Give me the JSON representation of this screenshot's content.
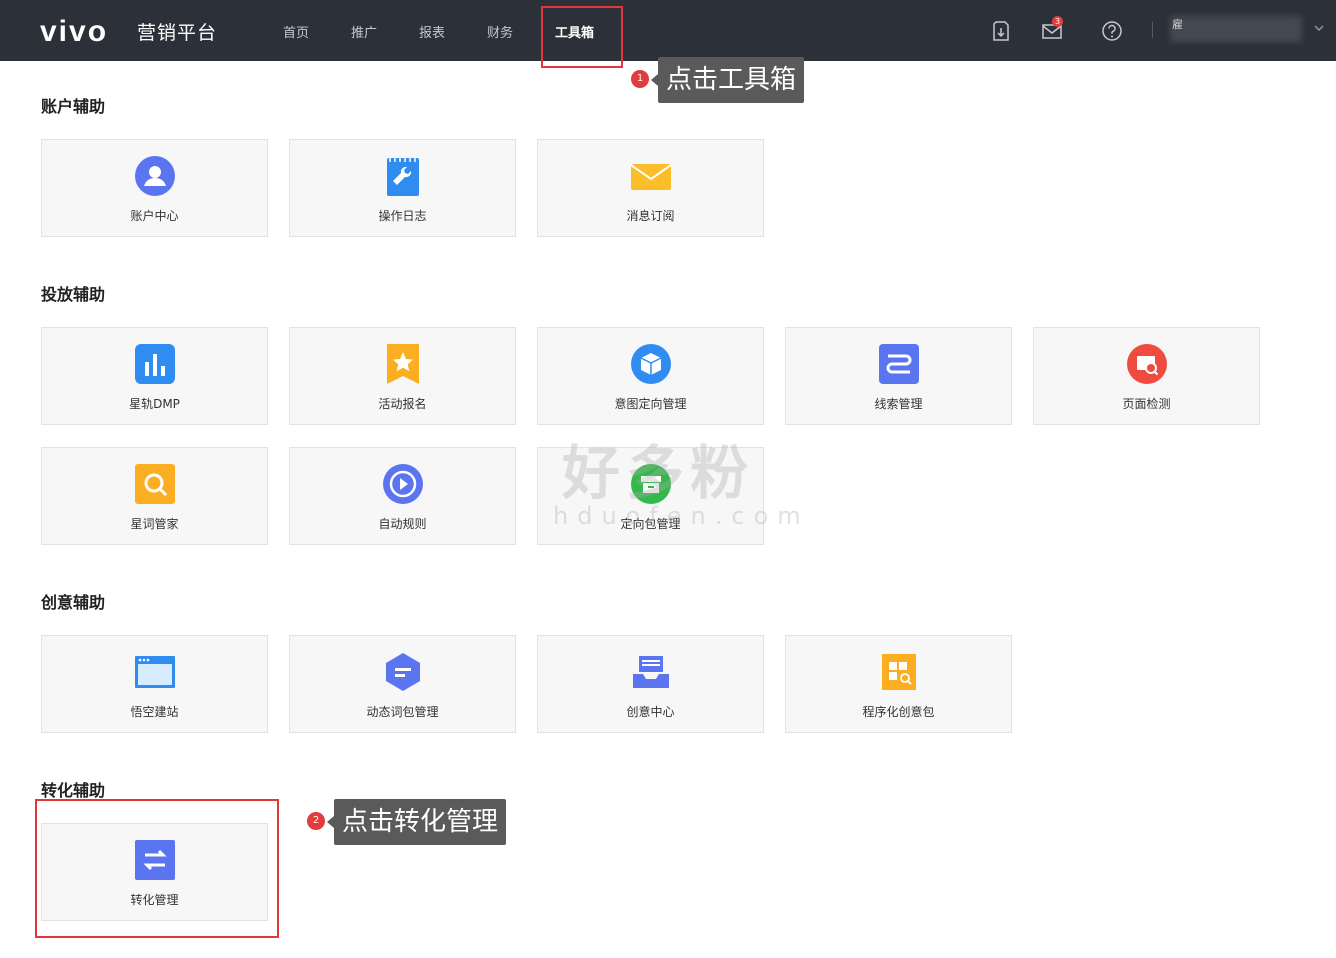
{
  "header": {
    "logo": "vivo",
    "platform": "营销平台",
    "nav": [
      "首页",
      "推广",
      "报表",
      "财务",
      "工具箱"
    ],
    "active_nav": "工具箱",
    "message_badge": "3",
    "user_initial": "雇"
  },
  "sections": [
    {
      "title": "账户辅助",
      "tools": [
        {
          "label": "账户中心",
          "icon": "user-icon"
        },
        {
          "label": "操作日志",
          "icon": "wrench-icon"
        },
        {
          "label": "消息订阅",
          "icon": "envelope-icon"
        }
      ]
    },
    {
      "title": "投放辅助",
      "tools": [
        {
          "label": "星轨DMP",
          "icon": "bar-chart-icon"
        },
        {
          "label": "活动报名",
          "icon": "star-badge-icon"
        },
        {
          "label": "意图定向管理",
          "icon": "cube-icon"
        },
        {
          "label": "线索管理",
          "icon": "route-icon"
        },
        {
          "label": "页面检测",
          "icon": "image-search-icon"
        },
        {
          "label": "星词管家",
          "icon": "search-icon"
        },
        {
          "label": "自动规则",
          "icon": "auto-play-icon"
        },
        {
          "label": "定向包管理",
          "icon": "package-icon"
        }
      ]
    },
    {
      "title": "创意辅助",
      "tools": [
        {
          "label": "悟空建站",
          "icon": "browser-icon"
        },
        {
          "label": "动态词包管理",
          "icon": "hexagon-icon"
        },
        {
          "label": "创意中心",
          "icon": "tray-icon"
        },
        {
          "label": "程序化创意包",
          "icon": "grid-doc-icon"
        }
      ]
    },
    {
      "title": "转化辅助",
      "tools": [
        {
          "label": "转化管理",
          "icon": "swap-icon"
        }
      ]
    }
  ],
  "callouts": [
    {
      "num": "1",
      "text": "点击工具箱"
    },
    {
      "num": "2",
      "text": "点击转化管理"
    }
  ],
  "watermark": {
    "text": "好多粉",
    "url": "hduofen.com"
  },
  "colors": {
    "topbar": "#2c3038",
    "highlight": "#e0373b",
    "card_bg": "#f7f7f8"
  }
}
